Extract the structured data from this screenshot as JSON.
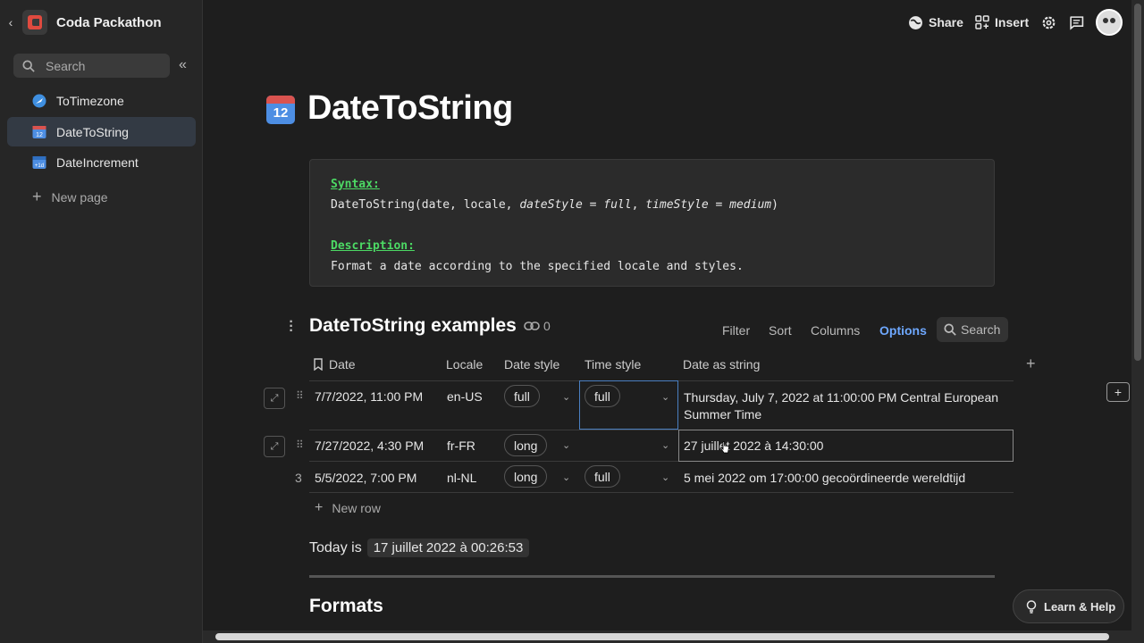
{
  "sidebar": {
    "doc_title": "Coda Packathon",
    "search_placeholder": "Search",
    "items": [
      {
        "label": "ToTimezone"
      },
      {
        "label": "DateToString"
      },
      {
        "label": "DateIncrement"
      }
    ],
    "new_page": "New page"
  },
  "topbar": {
    "share": "Share",
    "insert": "Insert"
  },
  "page": {
    "icon_number": "12",
    "title": "DateToString"
  },
  "code": {
    "syntax_label": "Syntax:",
    "syntax_prefix": "DateToString(date, locale, ",
    "syntax_arg1": "dateStyle = full",
    "syntax_sep": ", ",
    "syntax_arg2": "timeStyle = medium",
    "syntax_suffix": ")",
    "description_label": "Description:",
    "description": "Format a date according to the specified locale and styles."
  },
  "table": {
    "title": "DateToString examples",
    "link_count": "0",
    "actions": {
      "filter": "Filter",
      "sort": "Sort",
      "columns": "Columns",
      "options": "Options",
      "search": "Search"
    },
    "columns": [
      "Date",
      "Locale",
      "Date style",
      "Time style",
      "Date as string"
    ],
    "rows": [
      {
        "date": "7/7/2022, 11:00 PM",
        "locale": "en-US",
        "date_style": "full",
        "time_style": "full",
        "result_line1": "Thursday, July 7, 2022 at 11:00:00 PM Central European",
        "result_line2": "Summer Time"
      },
      {
        "date": "7/27/2022, 4:30 PM",
        "locale": "fr-FR",
        "date_style": "long",
        "time_style": "",
        "result_line1": "27 juillet 2022 à 14:30:00",
        "result_line2": ""
      },
      {
        "num": "3",
        "date": "5/5/2022, 7:00 PM",
        "locale": "nl-NL",
        "date_style": "long",
        "time_style": "full",
        "result_line1": "5 mei 2022 om 17:00:00 gecoördineerde wereldtijd",
        "result_line2": ""
      }
    ],
    "new_row": "New row"
  },
  "today": {
    "prefix": "Today is",
    "value": "17 juillet 2022 à 00:26:53"
  },
  "formats_heading": "Formats",
  "help": "Learn & Help",
  "colors": {
    "accent": "#6ea8ff",
    "keyword": "#4cd964",
    "brand": "#e04a3f"
  }
}
